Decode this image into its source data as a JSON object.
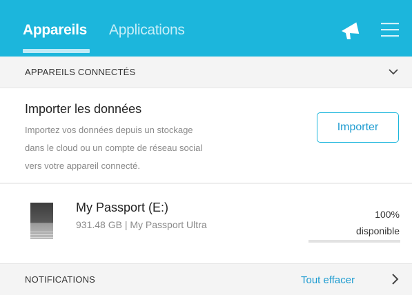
{
  "tabs": [
    {
      "label": "Appareils",
      "active": true
    },
    {
      "label": "Applications",
      "active": false
    }
  ],
  "header": {
    "announcement_icon": "megaphone-icon",
    "menu_icon": "hamburger-menu-icon",
    "accent_color": "#1cb6dc"
  },
  "connected_section": {
    "title": "APPAREILS CONNECTÉS",
    "toggle_icon": "chevron-down-icon"
  },
  "import": {
    "title": "Importer les données",
    "desc_lines": [
      "Importez vos données depuis un stockage",
      "dans le cloud ou un compte de réseau social",
      "vers votre appareil connecté."
    ],
    "button_label": "Importer"
  },
  "device": {
    "name": "My Passport (E:)",
    "detail": "931.48 GB | My Passport Ultra",
    "percent_label": "100%",
    "available_label": "disponible",
    "used_fraction": 0.0
  },
  "notifications": {
    "title": "NOTIFICATIONS",
    "clear_label": "Tout effacer",
    "expand_icon": "chevron-right-icon"
  }
}
